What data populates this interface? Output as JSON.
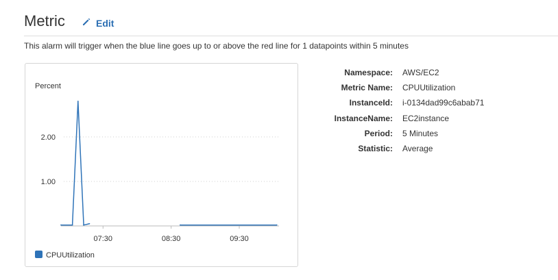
{
  "header": {
    "title": "Metric",
    "edit_label": "Edit"
  },
  "description": "This alarm will trigger when the blue line goes up to or above the red line for 1 datapoints within 5 minutes",
  "details": [
    {
      "label": "Namespace:",
      "value": "AWS/EC2"
    },
    {
      "label": "Metric Name:",
      "value": "CPUUtilization"
    },
    {
      "label": "InstanceId:",
      "value": "i-0134dad99c6abab71"
    },
    {
      "label": "InstanceName:",
      "value": "EC2instance"
    },
    {
      "label": "Period:",
      "value": "5 Minutes"
    },
    {
      "label": "Statistic:",
      "value": "Average"
    }
  ],
  "colors": {
    "series": "#2e73b8",
    "link": "#2c6fb3"
  },
  "icons": {
    "edit": "pencil-icon"
  },
  "chart_data": {
    "type": "line",
    "title": "",
    "ylabel": "Percent",
    "xlabel": "",
    "ylim": [
      0,
      3.0
    ],
    "yticks": [
      {
        "value": 1.0,
        "label": "1.00"
      },
      {
        "value": 2.0,
        "label": "2.00"
      }
    ],
    "xlim": [
      "06:53",
      "10:05"
    ],
    "xticks": [
      {
        "value": "07:30",
        "label": "07:30"
      },
      {
        "value": "08:30",
        "label": "08:30"
      },
      {
        "value": "09:30",
        "label": "09:30"
      }
    ],
    "grid": true,
    "legend": "bottom-left",
    "series": [
      {
        "name": "CPUUtilization",
        "segments": [
          [
            {
              "x": "06:53",
              "y": 0.02
            },
            {
              "x": "07:03",
              "y": 0.02
            },
            {
              "x": "07:08",
              "y": 2.8
            },
            {
              "x": "07:13",
              "y": 0.02
            }
          ],
          [
            {
              "x": "07:13",
              "y": 0.02
            },
            {
              "x": "07:18",
              "y": 0.05
            }
          ],
          [
            {
              "x": "08:38",
              "y": 0.02
            },
            {
              "x": "10:03",
              "y": 0.02
            }
          ]
        ]
      }
    ]
  }
}
